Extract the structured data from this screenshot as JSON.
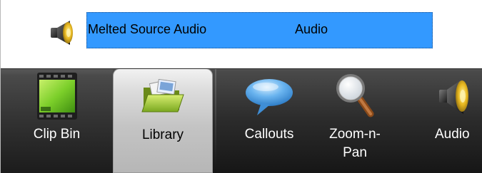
{
  "selected_item": {
    "name": "Melted Source Audio",
    "type": "Audio",
    "icon": "speaker-icon",
    "highlight_color": "#3399ff"
  },
  "toolbar": {
    "tabs": [
      {
        "label": "Clip Bin",
        "icon": "film-strip-icon",
        "active": false
      },
      {
        "label": "Library",
        "icon": "folder-media-icon",
        "active": true
      }
    ],
    "tools": [
      {
        "label": "Callouts",
        "icon": "speech-bubble-icon"
      },
      {
        "label": "Zoom-n-\nPan",
        "icon": "magnifier-icon"
      },
      {
        "label": "Audio",
        "icon": "speaker-icon"
      }
    ]
  }
}
